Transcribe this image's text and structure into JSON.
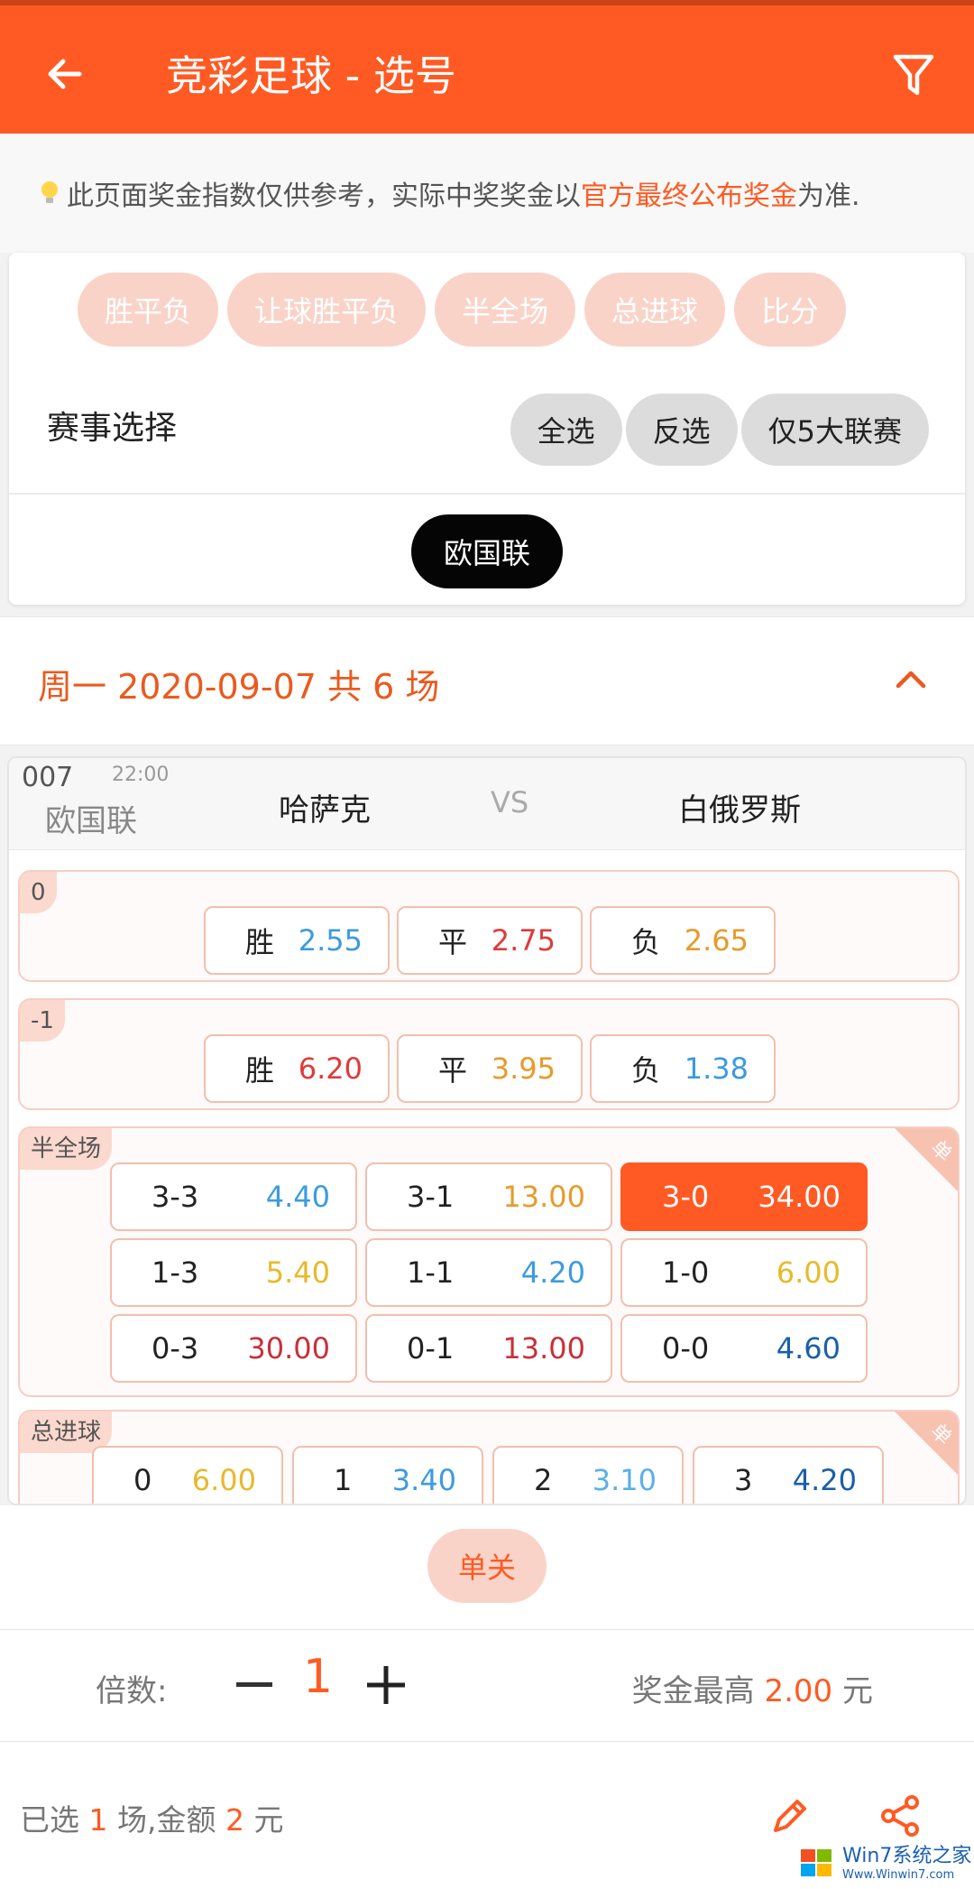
{
  "header": {
    "title": "竞彩足球 - 选号"
  },
  "notice": {
    "prefix": "此页面奖金指数仅供参考，实际中奖奖金以",
    "highlight": "官方最终公布奖金",
    "suffix": "为准."
  },
  "play_tabs": [
    "胜平负",
    "让球胜平负",
    "半全场",
    "总进球",
    "比分"
  ],
  "match_select": {
    "label": "赛事选择",
    "all": "全选",
    "invert": "反选",
    "top5": "仅5大联赛",
    "league_chip": "欧国联"
  },
  "date_section": {
    "text": "周一 2020-09-07 共 6 场"
  },
  "match": {
    "no": "007",
    "time": "22:00",
    "league": "欧国联",
    "home": "哈萨克",
    "vs": "VS",
    "away": "白俄罗斯",
    "spf": {
      "tag": "0",
      "odds": [
        {
          "label": "胜",
          "value": "2.55",
          "color": "#3c9be0"
        },
        {
          "label": "平",
          "value": "2.75",
          "color": "#e03a3a"
        },
        {
          "label": "负",
          "value": "2.65",
          "color": "#e89a2a"
        }
      ]
    },
    "rqspf": {
      "tag": "-1",
      "odds": [
        {
          "label": "胜",
          "value": "6.20",
          "color": "#e03a3a"
        },
        {
          "label": "平",
          "value": "3.95",
          "color": "#e89a2a"
        },
        {
          "label": "负",
          "value": "1.38",
          "color": "#3c9be0"
        }
      ]
    },
    "bqc": {
      "tag": "半全场",
      "badge": "单",
      "odds": [
        {
          "label": "3-3",
          "value": "4.40",
          "color": "#3c9be0",
          "selected": false
        },
        {
          "label": "3-1",
          "value": "13.00",
          "color": "#e89a2a",
          "selected": false
        },
        {
          "label": "3-0",
          "value": "34.00",
          "color": "#ffffff",
          "selected": true
        },
        {
          "label": "1-3",
          "value": "5.40",
          "color": "#e8b92a",
          "selected": false
        },
        {
          "label": "1-1",
          "value": "4.20",
          "color": "#3c9be0",
          "selected": false
        },
        {
          "label": "1-0",
          "value": "6.00",
          "color": "#e8b92a",
          "selected": false
        },
        {
          "label": "0-3",
          "value": "30.00",
          "color": "#c8303a",
          "selected": false
        },
        {
          "label": "0-1",
          "value": "13.00",
          "color": "#c8303a",
          "selected": false
        },
        {
          "label": "0-0",
          "value": "4.60",
          "color": "#1a5fa8",
          "selected": false
        }
      ]
    },
    "zjq": {
      "tag": "总进球",
      "badge": "单",
      "odds": [
        {
          "label": "0",
          "value": "6.00",
          "color": "#e8b92a"
        },
        {
          "label": "1",
          "value": "3.40",
          "color": "#3c9be0"
        },
        {
          "label": "2",
          "value": "3.10",
          "color": "#5ab0e8"
        },
        {
          "label": "3",
          "value": "4.20",
          "color": "#1a5fa8"
        }
      ]
    }
  },
  "single": {
    "label": "单关"
  },
  "multiplier": {
    "label": "倍数:",
    "value": "1",
    "prize_prefix": "奖金最高",
    "prize_value": "2.00",
    "prize_unit": "元"
  },
  "footer": {
    "p1": "已选",
    "count": "1",
    "p2": "场,金额",
    "amount": "2",
    "p3": "元"
  },
  "watermark": {
    "text": "Win7系统之家",
    "sub": "Www.Winwin7.com"
  },
  "colors": {
    "accent": "#ff5a23",
    "tab_bg": "#fad3c8"
  }
}
